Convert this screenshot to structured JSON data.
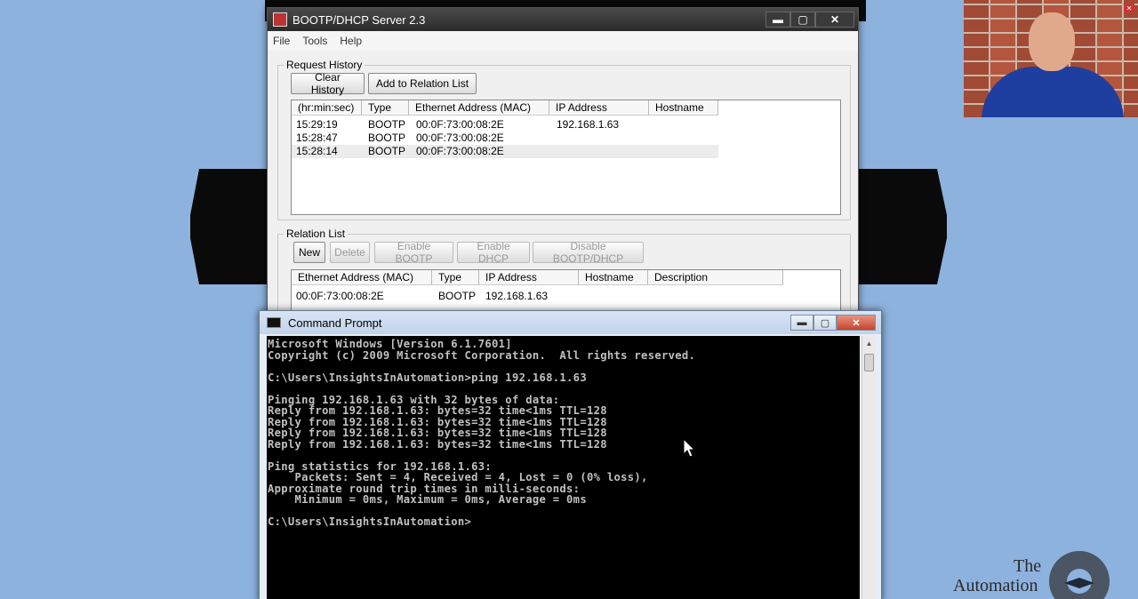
{
  "bootp_window": {
    "title": "BOOTP/DHCP Server 2.3",
    "controls": {
      "minimize": "▬",
      "maximize": "▢",
      "close": "✕"
    },
    "menu": [
      "File",
      "Tools",
      "Help"
    ],
    "request_history": {
      "label": "Request History",
      "buttons": {
        "clear": "Clear History",
        "add": "Add to Relation List"
      },
      "columns": [
        "(hr:min:sec)",
        "Type",
        "Ethernet Address (MAC)",
        "IP Address",
        "Hostname"
      ],
      "rows": [
        [
          "15:29:19",
          "BOOTP",
          "00:0F:73:00:08:2E",
          "192.168.1.63",
          ""
        ],
        [
          "15:28:47",
          "BOOTP",
          "00:0F:73:00:08:2E",
          "",
          ""
        ],
        [
          "15:28:14",
          "BOOTP",
          "00:0F:73:00:08:2E",
          "",
          ""
        ]
      ]
    },
    "relation_list": {
      "label": "Relation List",
      "buttons": {
        "new": "New",
        "delete": "Delete",
        "enable_bootp": "Enable BOOTP",
        "enable_dhcp": "Enable DHCP",
        "disable": "Disable BOOTP/DHCP"
      },
      "columns": [
        "Ethernet Address (MAC)",
        "Type",
        "IP Address",
        "Hostname",
        "Description"
      ],
      "rows": [
        [
          "00:0F:73:00:08:2E",
          "BOOTP",
          "192.168.1.63",
          "",
          ""
        ]
      ]
    }
  },
  "cmd_window": {
    "title": "Command Prompt",
    "controls": {
      "minimize": "▬",
      "maximize": "▢",
      "close": "✕"
    },
    "lines": [
      "Microsoft Windows [Version 6.1.7601]",
      "Copyright (c) 2009 Microsoft Corporation.  All rights reserved.",
      "",
      "C:\\Users\\InsightsInAutomation>ping 192.168.1.63",
      "",
      "Pinging 192.168.1.63 with 32 bytes of data:",
      "Reply from 192.168.1.63: bytes=32 time<1ms TTL=128",
      "Reply from 192.168.1.63: bytes=32 time<1ms TTL=128",
      "Reply from 192.168.1.63: bytes=32 time<1ms TTL=128",
      "Reply from 192.168.1.63: bytes=32 time<1ms TTL=128",
      "",
      "Ping statistics for 192.168.1.63:",
      "    Packets: Sent = 4, Received = 4, Lost = 0 (0% loss),",
      "Approximate round trip times in milli-seconds:",
      "    Minimum = 0ms, Maximum = 0ms, Average = 0ms",
      "",
      "C:\\Users\\InsightsInAutomation>"
    ]
  },
  "logo": {
    "line1": "The",
    "line2": "Automation"
  }
}
